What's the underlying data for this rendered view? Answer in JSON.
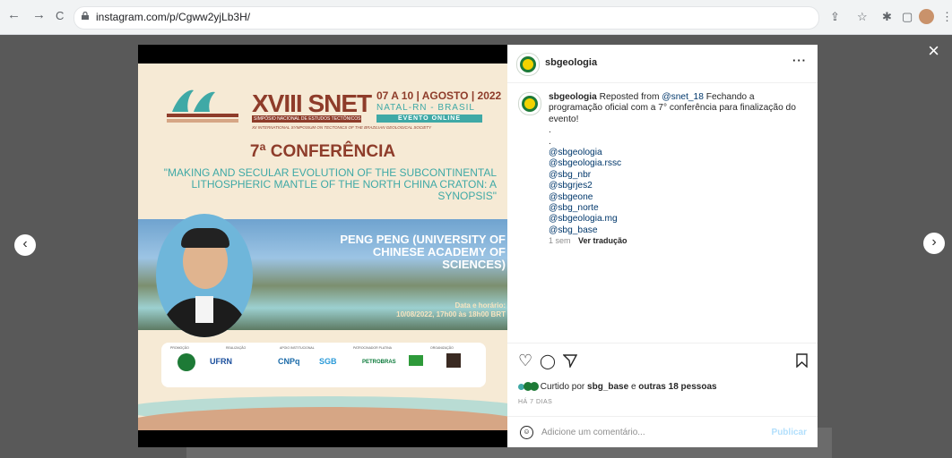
{
  "browser": {
    "url": "instagram.com/p/Cgww2yjLb3H/",
    "back": "←",
    "forward": "→",
    "reload": "C"
  },
  "modal": {
    "close": "×",
    "prev": "‹",
    "next": "›"
  },
  "poster": {
    "title": "XVIII SNET",
    "subtitle1": "SIMPÓSIO NACIONAL DE ESTUDOS TECTÔNICOS",
    "subtitle2": "XII INTERNATIONAL SYMPOSIUM ON TECTONICS OF THE BRAZILIAN GEOLOGICAL SOCIETY",
    "dates": "07 A 10 | AGOSTO | 2022",
    "location": "NATAL-RN - BRASIL",
    "online": "EVENTO ONLINE",
    "conference": "7ª CONFERÊNCIA",
    "talk_title": "\"MAKING AND SECULAR EVOLUTION OF THE SUBCONTINENTAL LITHOSPHERIC MANTLE OF THE NORTH CHINA CRATON: A SYNOPSIS\"",
    "speaker": "PENG PENG (UNIVERSITY OF CHINESE ACADEMY OF SCIENCES)",
    "when_label": "Data e horário:",
    "when": "10/08/2022, 17h00 às 18h00 BRT",
    "logo_sections": [
      "PROMOÇÃO",
      "REALIZAÇÃO",
      "APOIO INSTITUCIONAL",
      "PATROCINADOR PLATINA",
      "ORGANIZAÇÃO"
    ],
    "logos": [
      "UFRN",
      "CNPq",
      "SGB",
      "PETROBRAS"
    ]
  },
  "post": {
    "username": "sbgeologia",
    "more": "···",
    "caption_user": "sbgeologia",
    "caption_pre": "Reposted from",
    "caption_mention": "@snet_18",
    "caption_text": "Fechando a programação oficial com a 7° conferência para finalização do evento!",
    "dot1": ".",
    "dot2": ".",
    "tags": [
      "@sbgeologia",
      "@sbgeologia.rssc",
      "@sbg_nbr",
      "@sbgrjes2",
      "@sbgeone",
      "@sbg_norte",
      "@sbgeologia.mg",
      "@sbg_base"
    ],
    "age": "1 sem",
    "translate": "Ver tradução",
    "likes_pre": "Curtido por",
    "likes_user": "sbg_base",
    "likes_mid": "e",
    "likes_others": "outras 18 pessoas",
    "time": "HÁ 7 DIAS",
    "comment_placeholder": "Adicione um comentário...",
    "publish": "Publicar"
  }
}
